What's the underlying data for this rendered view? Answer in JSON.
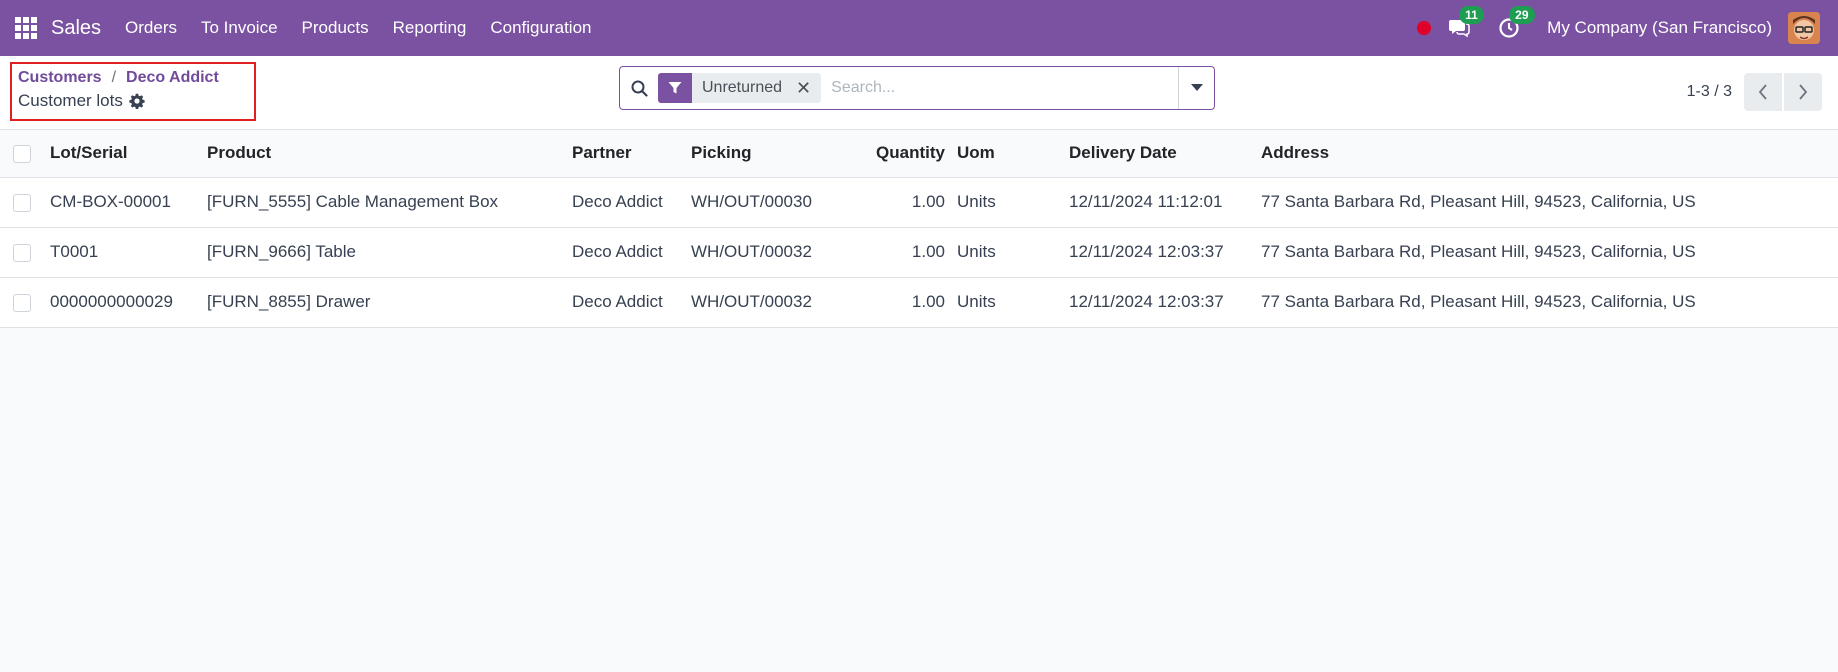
{
  "navbar": {
    "app_name": "Sales",
    "menu": [
      "Orders",
      "To Invoice",
      "Products",
      "Reporting",
      "Configuration"
    ],
    "messages_count": "11",
    "activities_count": "29",
    "company": "My Company (San Francisco)",
    "accent_color": "#7b52a1"
  },
  "breadcrumb": {
    "items": [
      "Customers",
      "Deco Addict"
    ],
    "title": "Customer lots"
  },
  "search": {
    "facet": "Unreturned",
    "placeholder": "Search..."
  },
  "pager": {
    "value": "1-3 / 3"
  },
  "table": {
    "columns": [
      "Lot/Serial",
      "Product",
      "Partner",
      "Picking",
      "Quantity",
      "Uom",
      "Delivery Date",
      "Address"
    ],
    "rows": [
      [
        "CM-BOX-00001",
        "[FURN_5555] Cable Management Box",
        "Deco Addict",
        "WH/OUT/00030",
        "1.00",
        "Units",
        "12/11/2024 11:12:01",
        "77 Santa Barbara Rd, Pleasant Hill, 94523, California, US"
      ],
      [
        "T0001",
        "[FURN_9666] Table",
        "Deco Addict",
        "WH/OUT/00032",
        "1.00",
        "Units",
        "12/11/2024 12:03:37",
        "77 Santa Barbara Rd, Pleasant Hill, 94523, California, US"
      ],
      [
        "0000000000029",
        "[FURN_8855] Drawer",
        "Deco Addict",
        "WH/OUT/00032",
        "1.00",
        "Units",
        "12/11/2024 12:03:37",
        "77 Santa Barbara Rd, Pleasant Hill, 94523, California, US"
      ]
    ]
  }
}
